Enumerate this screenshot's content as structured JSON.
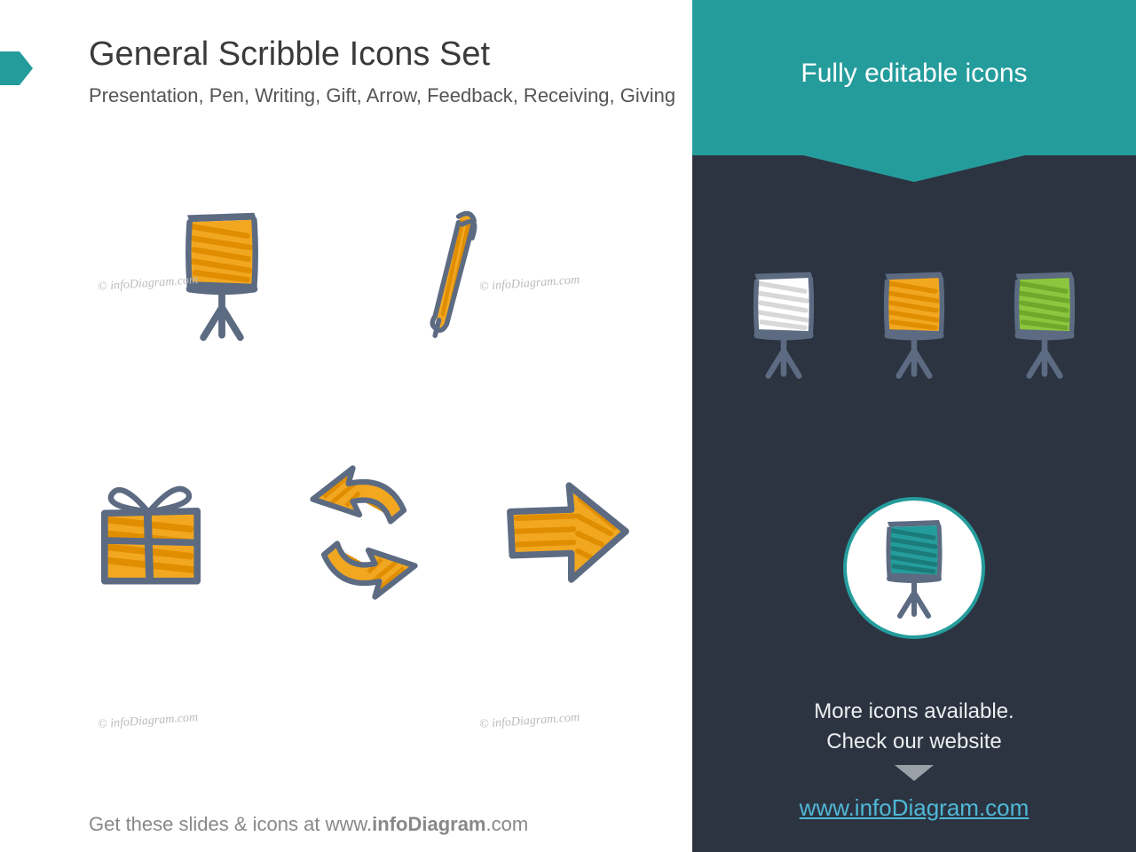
{
  "title": "General Scribble Icons Set",
  "subtitle": "Presentation, Pen, Writing,  Gift, Arrow, Feedback, Receiving, Giving",
  "right_header": "Fully editable icons",
  "right_more_line1": "More icons available.",
  "right_more_line2": "Check our website",
  "right_link": "www.infoDiagram.com",
  "footer_prefix": "Get these slides & icons at www.",
  "footer_bold": "infoDiagram",
  "footer_suffix": ".com",
  "watermark": "© infoDiagram.com",
  "colors": {
    "orange": "#f2a721",
    "outline": "#5c6b82",
    "teal": "#259c9c",
    "white": "#ffffff",
    "green": "#8cc63f"
  },
  "icons_left": [
    "presentation-board",
    "pen",
    "gift",
    "refresh-arrows",
    "arrow-right"
  ],
  "variants": [
    "white",
    "orange",
    "green"
  ],
  "circle_icon": "presentation-board"
}
